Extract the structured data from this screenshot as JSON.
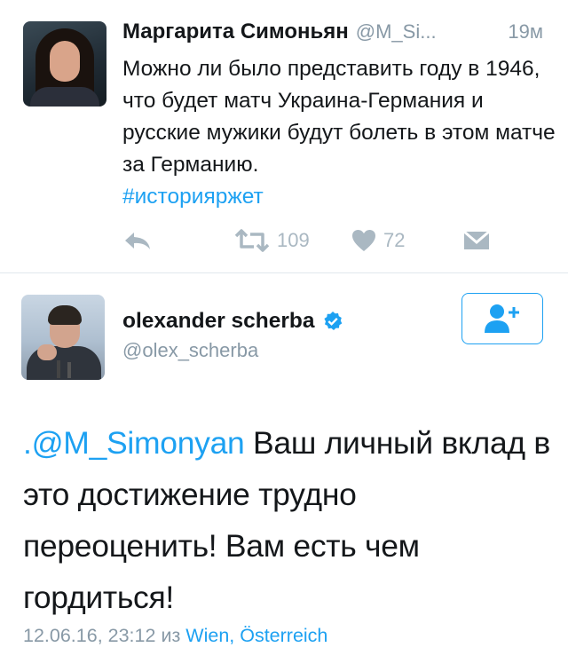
{
  "tweet1": {
    "author_name": "Маргарита Симоньян",
    "author_handle": "@M_Si...",
    "time_ago": "19м",
    "text": "Можно ли было представить году в 1946, что будет матч Украина-Германия и русские мужики будут болеть в этом матче за Германию.",
    "hashtag": "#историяржет",
    "actions": {
      "retweet_count": "109",
      "like_count": "72"
    }
  },
  "tweet2": {
    "author_name": "olexander scherba",
    "author_handle": "@olex_scherba",
    "verified": true,
    "mention": ".@M_Simonyan",
    "text": " Ваш личный вклад в это достижение трудно переоценить! Вам есть чем гордиться!",
    "date_time": "12.06.16, 23:12",
    "from_word": "из",
    "location": "Wien, Österreich"
  },
  "colors": {
    "accent": "#1da1f2",
    "muted": "#8899a6",
    "action_icon": "#aab8c2",
    "text": "#14171a",
    "divider": "#e1e8ed"
  },
  "icons": {
    "reply": "reply-icon",
    "retweet": "retweet-icon",
    "like": "heart-icon",
    "message": "envelope-icon",
    "verified": "verified-badge-icon",
    "follow": "follow-user-icon"
  }
}
